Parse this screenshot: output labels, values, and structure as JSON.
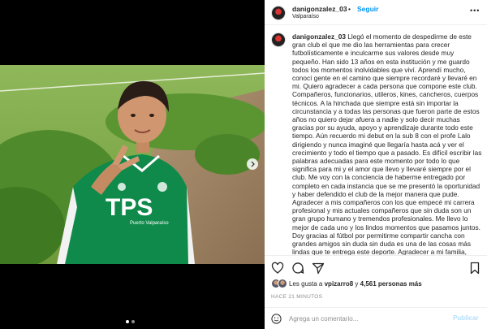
{
  "post": {
    "username": "danigonzalez_03",
    "dot": "•",
    "follow_label": "Seguir",
    "location": "Valparaíso",
    "more_label": "•••"
  },
  "caption": {
    "username": "danigonzalez_03",
    "text": "Llegó el momento de despedirme de este gran club el que me dio las herramientas para crecer futbolísticamente e inculcarme sus valores desde muy pequeño. Han sido 13 años en esta institución y me guardo todos los momentos inolvidables que viví. Aprendí mucho, conocí gente en el camino que siempre recordaré y llevaré en mi. Quiero agradecer a cada persona que compone este club. Compañeros, funcionarios, utileros, kines, cancheros, cuerpos técnicos. A la hinchada que siempre está sin importar la circunstancia y a todas las personas que fueron parte de estos años no quiero dejar afuera a nadie y solo decir muchas gracias por su ayuda, apoyo y aprendizaje durante todo este tiempo. Aún recuerdo mi debut en la sub 8 con el profe Lalo dirigiendo y nunca imaginé que llegaría hasta acá y ver el crecimiento y todo el tiempo que a pasado. Es difícil escribir las palabras adecuadas para este momento por todo lo que significa para mi y el amor que llevo y llevaré siempre por el club. Me voy con la conciencia de haberme entregado por completo en cada instancia que se me presentó la oportunidad y haber defendido el club de la mejor manera que pude. Agradecer a mis compañeros con los que empecé mi carrera profesional y mis actuales compañeros que sin duda son un gran grupo humano y tremendos profesionales. Me llevo lo mejor de cada uno y los lindos momentos que pasamos juntos. Doy gracias al fútbol por permitirme compartir cancha con grandes amigos sin duda sin duda es una de las cosas más lindas que te entrega este deporte. Agradecer a mi familia, amigos, mis garris y todas las personas que son parte de mi vida..."
  },
  "photo": {
    "shirt_text": "TPS",
    "shirt_subtext": "Puerto Valparaíso"
  },
  "likes": {
    "prefix": "Les gusta a",
    "user": "vpizarro8",
    "conjunction": "y",
    "count": "4,561 personas más"
  },
  "time_ago": "HACE 21 MINUTOS",
  "comment": {
    "placeholder": "Agrega un comentario...",
    "post_label": "Publicar"
  },
  "colors": {
    "accent": "#0095f6",
    "post_disabled": "#b2dffc",
    "shirt": "#0f8a4a"
  },
  "icons": [
    "heart-icon",
    "comment-icon",
    "share-icon",
    "bookmark-icon",
    "emoji-icon",
    "chevron-right-icon"
  ]
}
